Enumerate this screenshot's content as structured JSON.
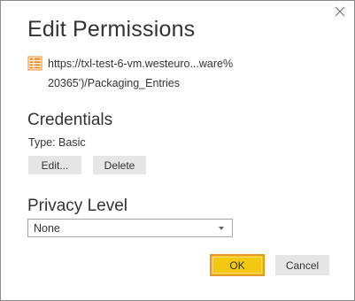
{
  "dialog": {
    "title": "Edit Permissions",
    "close_icon": "close-icon"
  },
  "source": {
    "icon": "table-icon",
    "url_line1": "https://txl-test-6-vm.westeuro...ware%",
    "url_line2": "20365')/Packaging_Entries"
  },
  "credentials": {
    "heading": "Credentials",
    "type_text": "Type: Basic",
    "edit_label": "Edit...",
    "delete_label": "Delete"
  },
  "privacy": {
    "heading": "Privacy Level",
    "selected": "None",
    "arrow_icon": "chevron-down-icon"
  },
  "footer": {
    "ok_label": "OK",
    "cancel_label": "Cancel"
  },
  "colors": {
    "ok_button": "#f2c811",
    "ok_border": "#e49a2c",
    "source_icon": "#f08a24"
  }
}
